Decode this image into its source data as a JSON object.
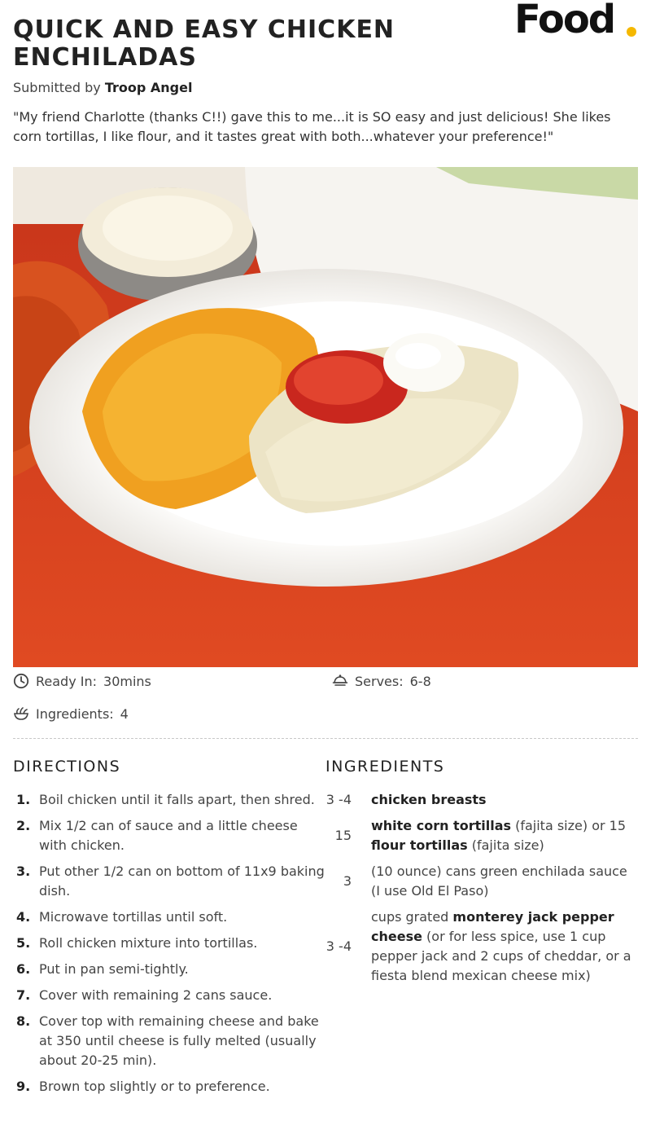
{
  "brand": {
    "logo_text": "Food",
    "accent": "#f5b800"
  },
  "recipe": {
    "title": "QUICK AND EASY CHICKEN ENCHILADAS",
    "submitted_prefix": "Submitted by",
    "author": "Troop Angel",
    "description": "\"My friend Charlotte (thanks C!!) gave this to me...it is SO easy and just delicious! She likes corn tortillas, I like flour, and it tastes great with both...whatever your preference!\""
  },
  "meta": {
    "ready_label": "Ready In:",
    "ready_value": "30mins",
    "serves_label": "Serves:",
    "serves_value": "6-8",
    "ingredients_label": "Ingredients:",
    "ingredients_value": "4"
  },
  "directions": {
    "heading": "DIRECTIONS",
    "steps": [
      {
        "num": "1.",
        "text": "Boil chicken until it falls apart, then shred."
      },
      {
        "num": "2.",
        "text": "Mix 1/2 can of sauce and a little cheese with chicken."
      },
      {
        "num": "3.",
        "text": "Put other 1/2 can on bottom of 11x9 baking dish."
      },
      {
        "num": "4.",
        "text": "Microwave tortillas until soft."
      },
      {
        "num": "5.",
        "text": "Roll chicken mixture into tortillas."
      },
      {
        "num": "6.",
        "text": "Put in pan semi-tightly."
      },
      {
        "num": "7.",
        "text": "Cover with remaining 2 cans sauce."
      },
      {
        "num": "8.",
        "text": "Cover top with remaining cheese and bake at 350 until cheese is fully melted (usually about 20-25 min)."
      },
      {
        "num": "9.",
        "text": "Brown top slightly or to preference."
      }
    ]
  },
  "ingredients": {
    "heading": "INGREDIENTS",
    "items": [
      {
        "qty": "3 -4",
        "parts": [
          {
            "b": "chicken breasts"
          }
        ]
      },
      {
        "qty": "15",
        "parts": [
          {
            "b": "white corn tortillas"
          },
          {
            "t": " (fajita size) or 15 "
          },
          {
            "b": "flour tortillas"
          },
          {
            "t": " (fajita size)"
          }
        ]
      },
      {
        "qty": "3",
        "parts": [
          {
            "t": "(10 ounce) cans green enchilada sauce (I use Old El Paso)"
          }
        ]
      },
      {
        "qty": "3 -4",
        "parts": [
          {
            "t": "cups grated "
          },
          {
            "b": "monterey jack pepper cheese"
          },
          {
            "t": " (or for less spice, use 1 cup pepper jack and 2 cups of cheddar, or a fiesta blend mexican cheese mix)"
          }
        ]
      }
    ]
  },
  "colors": {
    "table": "#d63e1c",
    "rice": "#f0a020",
    "plate": "#f7f5f2"
  }
}
